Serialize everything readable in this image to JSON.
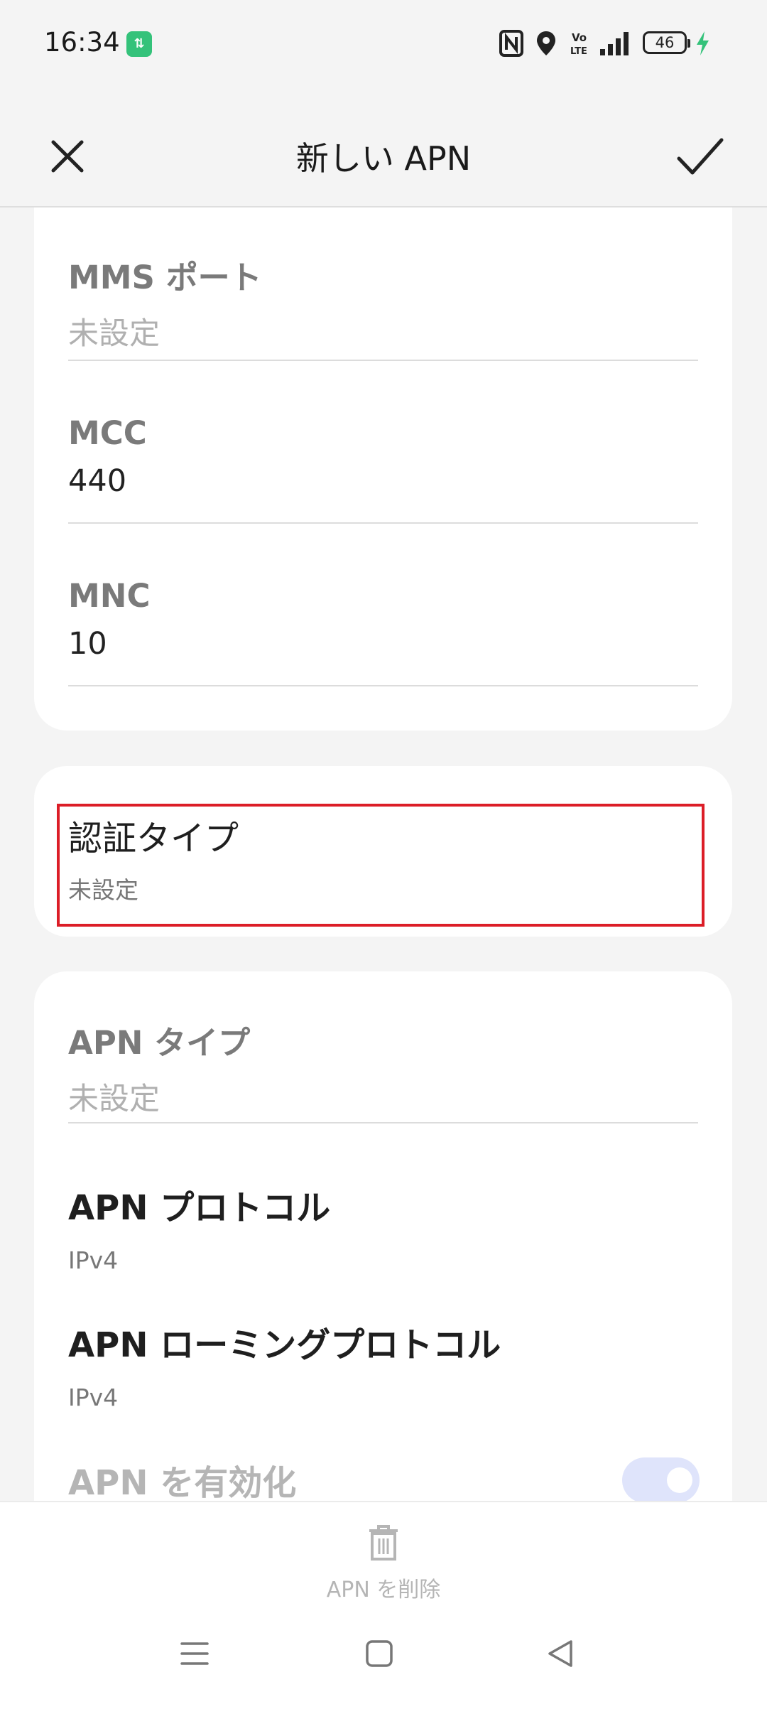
{
  "status_bar": {
    "time": "16:34",
    "data_badge": "⇅",
    "battery": "46",
    "icons": [
      "nfc-icon",
      "location-icon",
      "volte-icon",
      "signal-icon",
      "battery-icon",
      "charging-icon"
    ]
  },
  "app_bar": {
    "title": "新しい APN",
    "close_icon": "close-icon",
    "confirm_icon": "check-icon"
  },
  "card1": {
    "fields": [
      {
        "label": "MMS ポート",
        "value": "未設定",
        "placeholder": true
      },
      {
        "label": "MCC",
        "value": "440",
        "placeholder": false
      },
      {
        "label": "MNC",
        "value": "10",
        "placeholder": false
      }
    ]
  },
  "card2": {
    "title": "認証タイプ",
    "value": "未設定"
  },
  "card3": {
    "apn_type": {
      "label": "APN タイプ",
      "value": "未設定"
    },
    "apn_protocol": {
      "label": "APN プロトコル",
      "value": "IPv4"
    },
    "apn_roaming_protocol": {
      "label": "APN ローミングプロトコル",
      "value": "IPv4"
    },
    "apn_enable": {
      "label": "APN を有効化",
      "enabled": true
    }
  },
  "bottom": {
    "delete_label": "APN を削除",
    "delete_icon": "trash-icon"
  },
  "nav": {
    "icons": [
      "menu-icon",
      "home-icon",
      "back-icon"
    ]
  },
  "colors": {
    "background": "#f4f4f4",
    "card": "#ffffff",
    "highlight": "#dc1d27",
    "toggle_track": "#dfe4fb",
    "data_badge": "#34c27a",
    "charging": "#34c27a"
  }
}
